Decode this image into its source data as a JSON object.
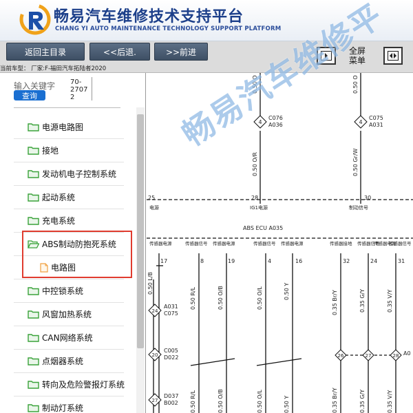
{
  "header": {
    "title_cn": "畅易汽车维修技术支持平台",
    "title_en": "CHANG YI AUTO MAINTENANCE TECHNOLOGY SUPPORT PLATFORM",
    "brand_color": "#1c3f8a"
  },
  "toolbar": {
    "home_label": "返回主目录",
    "back_label": "<<后退.",
    "forward_label": ">>前进",
    "fullscreen_line1": "全屏",
    "fullscreen_line2": "菜单",
    "vehicle_info": "当前车型： 厂家:F-福田汽车拓陆者2020"
  },
  "search": {
    "label": "输入关键字",
    "value": "70-27072",
    "button": "查询"
  },
  "tree": {
    "items": [
      {
        "label": "电源电路图",
        "type": "folder"
      },
      {
        "label": "接地",
        "type": "folder"
      },
      {
        "label": "发动机电子控制系统",
        "type": "folder"
      },
      {
        "label": "起动系统",
        "type": "folder"
      },
      {
        "label": "充电系统",
        "type": "folder"
      },
      {
        "label": "ABS制动防抱死系统",
        "type": "folder-open"
      },
      {
        "label": "电路图",
        "type": "document"
      },
      {
        "label": "中控锁系统",
        "type": "folder"
      },
      {
        "label": "风窗加热系统",
        "type": "folder"
      },
      {
        "label": "CAN网络系统",
        "type": "folder"
      },
      {
        "label": "点烟器系统",
        "type": "folder"
      },
      {
        "label": "转向及危险警报灯系统",
        "type": "folder"
      },
      {
        "label": "制动灯系统",
        "type": "folder"
      }
    ],
    "folder_color": "#3aa23a",
    "highlight_color": "#e03b2e"
  },
  "diagram": {
    "watermark": "畅易汽车维修平",
    "ecu_label": "ABS ECU  A035",
    "ig1_label": "IG1电源",
    "power_label": "电源",
    "signal_label": "制动信号",
    "connectors_top": [
      {
        "id": "C076",
        "sub": "A036",
        "num": "4"
      },
      {
        "id": "C075",
        "sub": "A031",
        "num": "4"
      }
    ],
    "pin_numbers_top": [
      "25",
      "28",
      "30"
    ],
    "wires_top": [
      "0.50 O/R",
      "0.50 Gr/W"
    ],
    "wires_top_upper": [
      "0.50 O",
      "0.50 O"
    ],
    "pin_labels": [
      "传感器电源",
      "传感器信号",
      "传感器电源",
      "传感器信号",
      "传感器电源",
      "传感器接地",
      "传感器信号",
      "传感器电源",
      "传感器信号"
    ],
    "pin_numbers": [
      "17",
      "8",
      "19",
      "4",
      "16",
      "32",
      "24",
      "31"
    ],
    "wires_bottom": [
      "0.50 L/B",
      "0.50 R/L",
      "0.50 O/B",
      "0.50 O/L",
      "0.50 Y",
      "0.35 Br/Y",
      "0.35 G/Y",
      "0.35 V/Y"
    ],
    "wires_lower": [
      "0.50 L/B",
      "0.50 R/L",
      "0.50 O/B",
      "0.50 O/L",
      "0.50 Y",
      "0.35 Br/Y",
      "0.35 G/Y",
      "0.35 V/Y"
    ],
    "connectors_side": [
      {
        "id": "A031",
        "sub": "C075",
        "num": "24"
      },
      {
        "id": "C005",
        "sub": "D022",
        "num": "20"
      },
      {
        "id": "D037",
        "sub": "B002",
        "num": "27"
      }
    ],
    "connectors_right": [
      "26",
      "27",
      "28"
    ],
    "right_conn_label": "A0"
  }
}
